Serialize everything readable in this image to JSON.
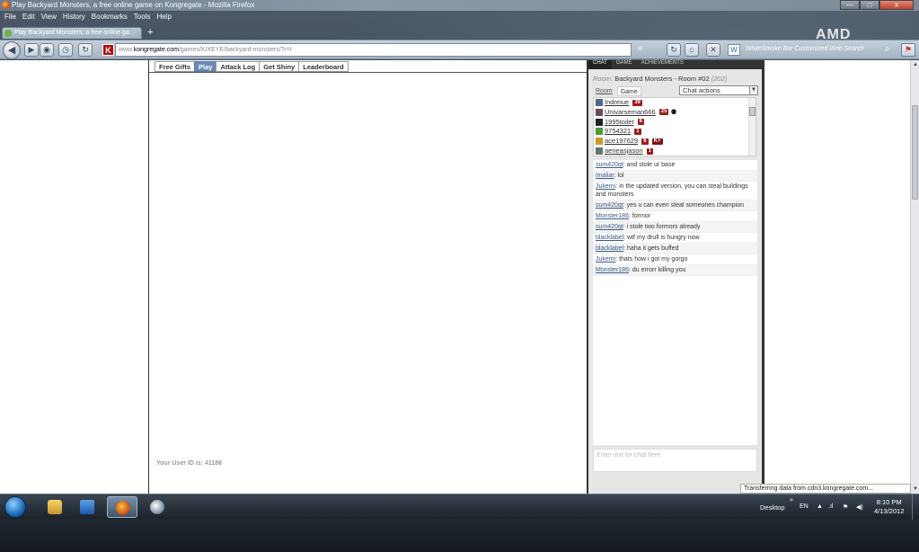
{
  "window": {
    "title": "Play Backyard Monsters, a free online game on Kongregate - Mozilla Firefox",
    "controls": {
      "minimize": "—",
      "maximize": "□",
      "close": "x"
    }
  },
  "menu": [
    "File",
    "Edit",
    "View",
    "History",
    "Bookmarks",
    "Tools",
    "Help"
  ],
  "tabs": {
    "active_label": "Play Backyard Monsters, a free online ga...",
    "new_tab": "+"
  },
  "nav": {
    "url_prefix": "www.",
    "url_domain": "kongregate.com",
    "url_path": "/games/KIXEYE/backyard-monsters/?r=t",
    "site_badge": "K",
    "search_placeholder": "WhiteSmoke Bar Customized Web Search",
    "brand": "AMD"
  },
  "game": {
    "tabs": [
      {
        "label": "Free Gifts",
        "active": false
      },
      {
        "label": "Play",
        "active": true
      },
      {
        "label": "Attack Log",
        "active": false
      },
      {
        "label": "Get Shiny",
        "active": false
      },
      {
        "label": "Leaderboard",
        "active": false
      }
    ],
    "user_id_text": "Your User ID is: 41186"
  },
  "chat": {
    "tabs": [
      "Chat",
      "Game",
      "Achievements"
    ],
    "room_label": "Room:",
    "room_name": "Backyard Monsters - Room #02",
    "room_count": "(202)",
    "room_tabs": [
      "Room",
      "Game"
    ],
    "actions_label": "Chat actions",
    "users": [
      {
        "name": "Indreiue",
        "level": "39",
        "extra": ""
      },
      {
        "name": "Univarseman666",
        "level": "25",
        "extra": ""
      },
      {
        "name": "1995toilet",
        "level": "6",
        "extra": ""
      },
      {
        "name": "9754321",
        "level": "1",
        "extra": ""
      },
      {
        "name": "ace197629",
        "level": "6",
        "extra": "K+"
      },
      {
        "name": "aeneasjason",
        "level": "1",
        "extra": ""
      }
    ],
    "messages": [
      {
        "who": "sum420qt",
        "text": ": and stole ur base"
      },
      {
        "who": "imaliar",
        "text": ": lol"
      },
      {
        "who": "Jukemi",
        "text": ": in the updated version, you can steal buildings and monsters"
      },
      {
        "who": "sum420qt",
        "text": ": yes u can even steal someones champion"
      },
      {
        "who": "Monster186",
        "text": ": formor"
      },
      {
        "who": "sum420qt",
        "text": ": i stole two formors already"
      },
      {
        "who": "blacklabel",
        "text": ": wtf my drull is hungry now"
      },
      {
        "who": "blacklabel",
        "text": ": haha it gets buffed"
      },
      {
        "who": "Jukemi",
        "text": ": thats how i got my gorgo"
      },
      {
        "who": "Monster186",
        "text": ": du errorr killing you"
      }
    ],
    "input_placeholder": "Enter text for chat here"
  },
  "status": "Transferring data from cdn3.kongregate.com...",
  "taskbar": {
    "desktop_label": "Desktop",
    "chevron": "»",
    "lang": "EN",
    "time": "8:10 PM",
    "date": "4/13/2012"
  }
}
